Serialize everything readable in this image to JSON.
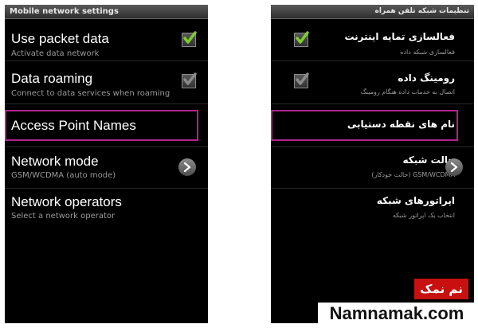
{
  "left": {
    "title": "Mobile network settings",
    "rows": [
      {
        "label": "Use packet data",
        "summary": "Activate data network",
        "checked": true
      },
      {
        "label": "Data roaming",
        "summary": "Connect to data services when roaming",
        "checked": true
      },
      {
        "label": "Access Point Names",
        "highlighted": true
      },
      {
        "label": "Network mode",
        "summary": "GSM/WCDMA (auto mode)"
      },
      {
        "label": "Network operators",
        "summary": "Select a network operator"
      }
    ]
  },
  "right": {
    "title": "تنظیمات شبکه تلفن همراه",
    "rows": [
      {
        "label": "فعالسازی تمایه اینترنت",
        "summary": "فعالسازی شبکه داده",
        "checked": true
      },
      {
        "label": "رومینگ داده",
        "summary": "اتصال به خدمات داده هنگام رومینگ",
        "checked": true
      },
      {
        "label": "نام های نقطه دستیابی",
        "highlighted": true
      },
      {
        "label": "حالت شبکه",
        "summary": "GSM/WCDMA (حالت خودکار)"
      },
      {
        "label": "اپراتورهای شبکه",
        "summary": "انتخاب یک اپراتور شبکه"
      }
    ]
  },
  "watermark": {
    "brand": "نم نمک",
    "site": "Namnamak.com"
  },
  "colors": {
    "highlight": "#b0248a",
    "check": "#7ccd2c",
    "brand_red": "#c81010"
  },
  "icons": {
    "checkbox": "checkmark-icon",
    "chevron": "chevron-right-icon"
  }
}
